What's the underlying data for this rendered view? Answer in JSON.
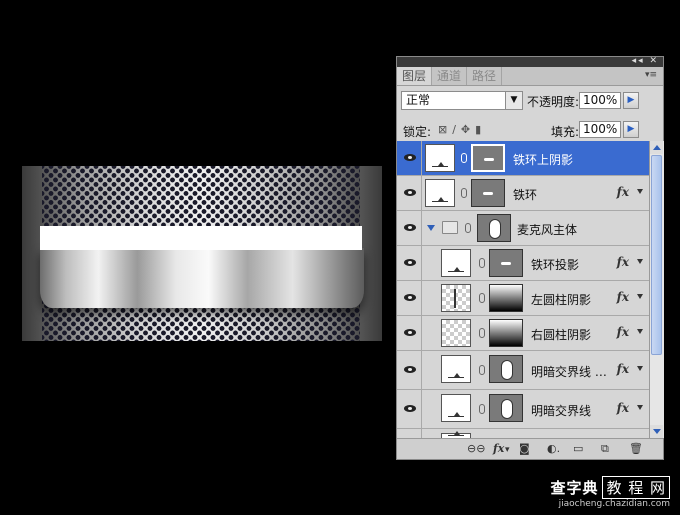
{
  "panel": {
    "tabs": [
      "图层",
      "通道",
      "路径"
    ],
    "active_tab": 0,
    "blend_mode": "正常",
    "opacity_label": "不透明度:",
    "opacity_value": "100%",
    "lock_label": "锁定:",
    "fill_label": "填充:",
    "fill_value": "100%"
  },
  "layers": [
    {
      "name": "铁环上阴影",
      "selected": true,
      "fx": false
    },
    {
      "name": "铁环",
      "selected": false,
      "fx": true
    },
    {
      "name": "麦克风主体",
      "group": true,
      "fx": false
    },
    {
      "name": "铁环投影",
      "selected": false,
      "fx": true
    },
    {
      "name": "左圆柱阴影",
      "selected": false,
      "fx": true
    },
    {
      "name": "右圆柱阴影",
      "selected": false,
      "fx": true
    },
    {
      "name": "明暗交界线 …",
      "selected": false,
      "fx": true
    },
    {
      "name": "明暗交界线",
      "selected": false,
      "fx": true
    }
  ],
  "fx_label": "fx",
  "watermark": {
    "line1": "查字典",
    "line1_box": "教 程 网",
    "line2": "jiaocheng.chazidian.com"
  }
}
